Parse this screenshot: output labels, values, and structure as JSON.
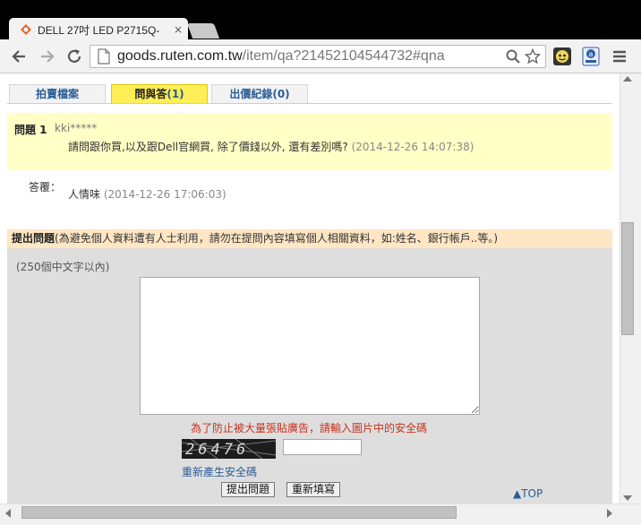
{
  "browser": {
    "tab_title": "DELL 27吋 LED P2715Q-",
    "tab_close": "×",
    "url_host": "goods.ruten.com.tw",
    "url_path": "/item/qa?21452104544732#qna"
  },
  "page_tabs": [
    {
      "label": "拍賣檔案",
      "count": ""
    },
    {
      "label": "問與答",
      "count": "(1)"
    },
    {
      "label": "出價紀錄",
      "count": "(0)"
    }
  ],
  "question": {
    "label": "問題 1",
    "user": "kki*****",
    "text": "請問跟你買,以及跟Dell官網買, 除了價錢以外, 還有差別嗎?",
    "time": "(2014-12-26 14:07:38)"
  },
  "answer": {
    "label": "答覆：",
    "text": "人情味",
    "time": "(2014-12-26 17:06:03)"
  },
  "ask_form": {
    "heading_bold": "提出問題",
    "heading_note": "(為避免個人資料遭有人士利用，請勿在提問內容填寫個人相關資料，如:姓名、銀行帳戶..等。)",
    "limit_note": "(250個中文字以內)",
    "captcha_note": "為了防止被大量張貼廣告，請輸入圖片中的安全碼",
    "captcha_code": "26476",
    "regen_link": "重新產生安全碼",
    "submit_label": "提出問題",
    "reset_label": "重新填寫"
  },
  "top_link": "▲TOP",
  "colors": {
    "question_bg": "#ffffc6",
    "ask_head_bg": "#ffe6c4",
    "active_tab": "#ffee55",
    "link": "#2a5c97",
    "captcha_note": "#c8321c"
  }
}
